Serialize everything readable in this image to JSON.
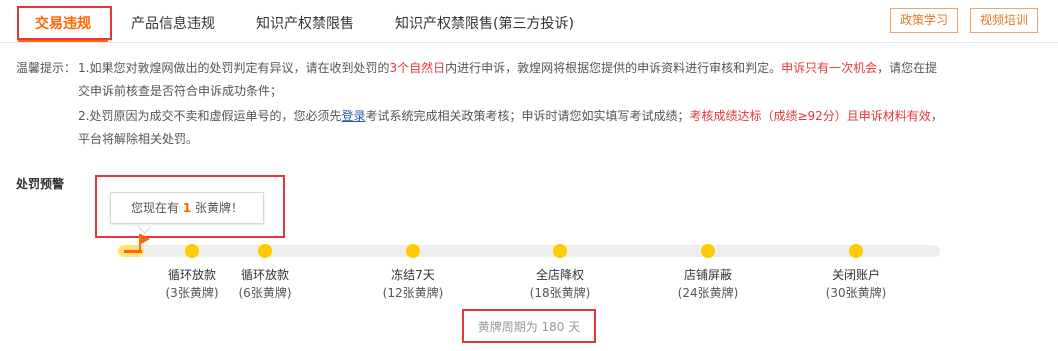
{
  "tabs": [
    {
      "label": "交易违规"
    },
    {
      "label": "产品信息违规"
    },
    {
      "label": "知识产权禁限售"
    },
    {
      "label": "知识产权禁限售(第三方投诉)"
    }
  ],
  "header_buttons": {
    "policy_study": "政策学习",
    "video_training": "视频培训"
  },
  "notice": {
    "label": "温馨提示：",
    "line1_a": "1.如果您对敦煌网做出的处罚判定有异议，请在收到处罚的",
    "line1_red1": "3个自然日",
    "line1_b": "内进行申诉，敦煌网将根据您提供的申诉资料进行审核和判定。",
    "line1_red2": "申诉只有一次机会",
    "line1_c": "，请您在提",
    "line2": "交申诉前核查是否符合申诉成功条件；",
    "line3_a": "2.处罚原因为成交不卖和虚假运单号的，您必须先",
    "line3_link": "登录",
    "line3_b": "考试系统完成相关政策考核；申诉时请您如实填写考试成绩；",
    "line3_red": "考核成绩达标（成绩≥92分）且申诉材料有效",
    "line3_c": "，",
    "line4": "平台将解除相关处罚。"
  },
  "punishment": {
    "title": "处罚预警",
    "tooltip_prefix": "您现在有 ",
    "tooltip_count": "1",
    "tooltip_suffix": " 张黄牌！",
    "current_yellow_cards": 1,
    "max_yellow_cards": 30,
    "steps": [
      {
        "label": "循环放款",
        "count": "(3张黄牌)"
      },
      {
        "label": "循环放款",
        "count": "(6张黄牌)"
      },
      {
        "label": "冻结7天",
        "count": "(12张黄牌)"
      },
      {
        "label": "全店降权",
        "count": "(18张黄牌)"
      },
      {
        "label": "店铺屏蔽",
        "count": "(24张黄牌)"
      },
      {
        "label": "关闭账户",
        "count": "(30张黄牌)"
      }
    ],
    "period": "黄牌周期为 180 天"
  },
  "colors": {
    "accent": "#ff6600",
    "highlight_red": "#e4393c",
    "dot_yellow": "#ffcc00",
    "link_blue": "#2a5db0"
  }
}
